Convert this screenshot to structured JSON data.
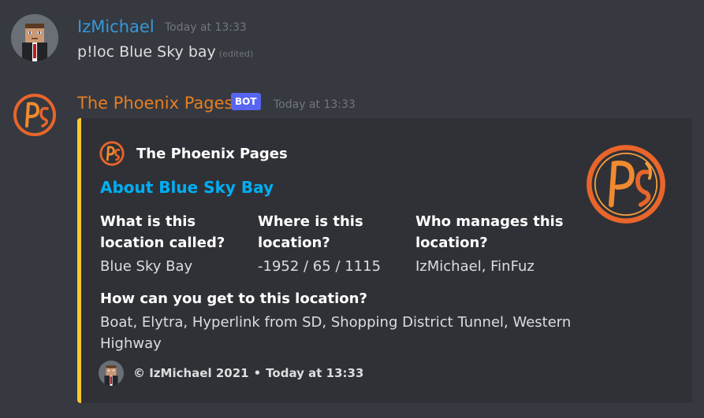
{
  "messages": [
    {
      "username": "IzMichael",
      "username_color": "#3498db",
      "timestamp": "Today at 13:33",
      "content": "p!loc Blue Sky bay",
      "edited": "(edited)"
    },
    {
      "username": "The Phoenix Pages",
      "username_color": "#e67e22",
      "bot_tag": "BOT",
      "timestamp": "Today at 13:33",
      "embed": {
        "accent_color": "#fdc82f",
        "author_name": "The Phoenix Pages",
        "title": "About Blue Sky Bay",
        "fields": [
          {
            "name": "What is this location called?",
            "value": "Blue Sky Bay"
          },
          {
            "name": "Where is this location?",
            "value": "-1952 / 65 / 1115"
          },
          {
            "name": "Who manages this location?",
            "value": "IzMichael, FinFuz"
          },
          {
            "name": "How can you get to this location?",
            "value": "Boat, Elytra, Hyperlink from SD, Shopping District Tunnel, Western Highway"
          }
        ],
        "footer_text": "© IzMichael 2021",
        "footer_separator": "•",
        "footer_timestamp": "Today at 13:33"
      }
    }
  ]
}
